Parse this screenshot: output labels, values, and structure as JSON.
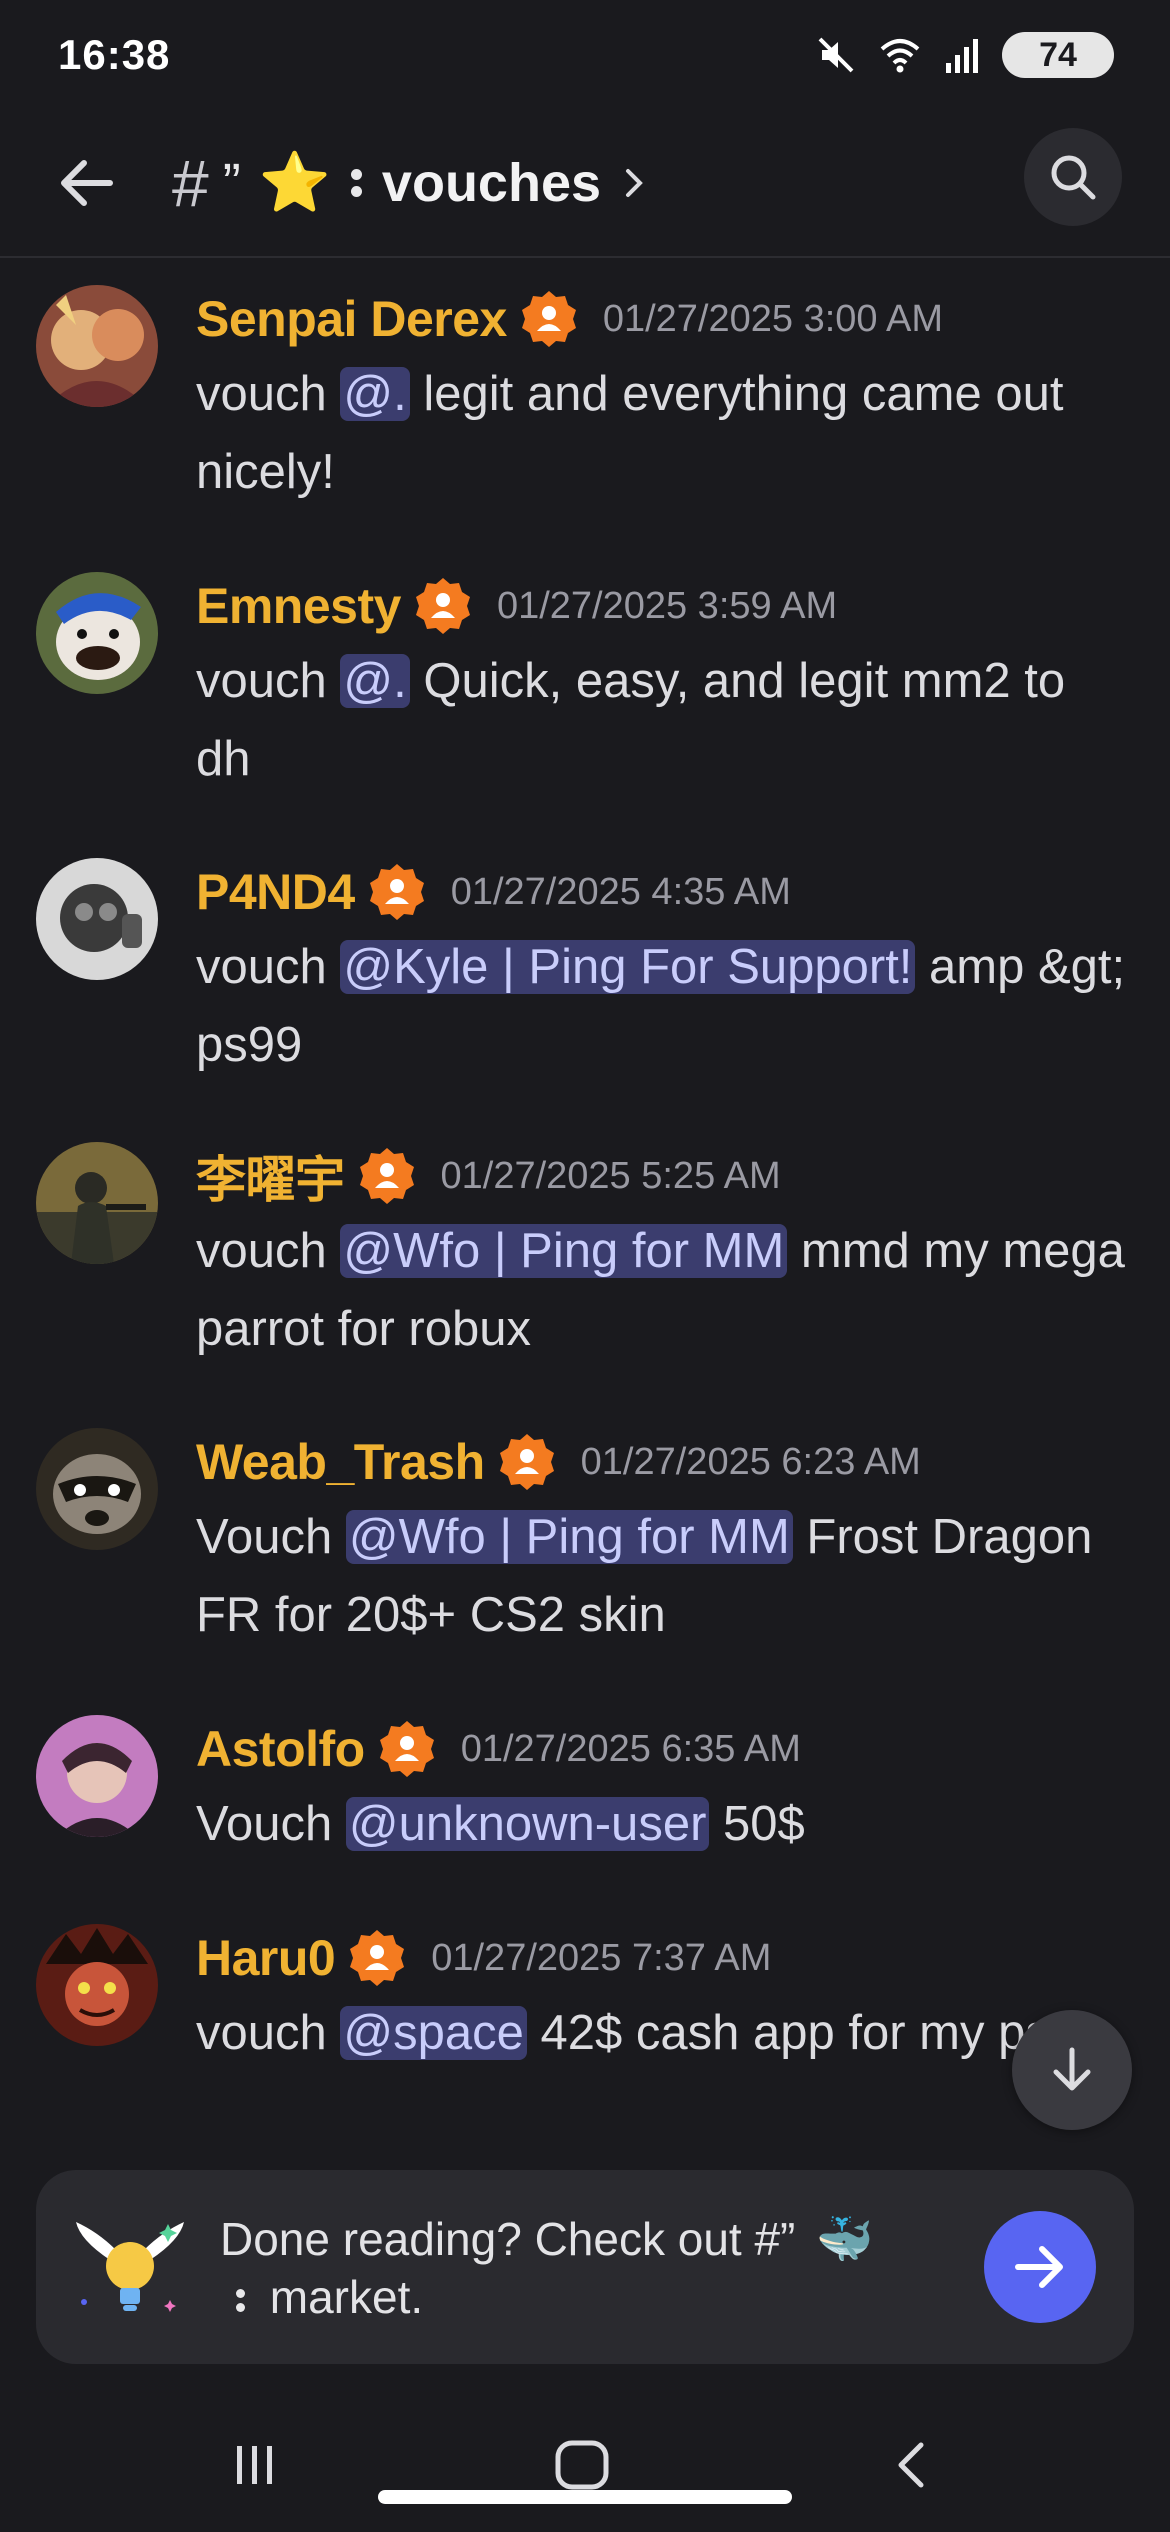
{
  "status_bar": {
    "time": "16:38",
    "battery": "74"
  },
  "header": {
    "hash": "#",
    "quote": "”",
    "star": "⭐",
    "channel_name": "vouches"
  },
  "messages": [
    {
      "username": "Senpai Derex",
      "timestamp": "01/27/2025 3:00 AM",
      "parts": [
        {
          "t": "text",
          "v": "vouch "
        },
        {
          "t": "mention",
          "v": "@."
        },
        {
          "t": "text",
          "v": " legit and everything came out nicely!"
        }
      ]
    },
    {
      "username": "Emnesty",
      "timestamp": "01/27/2025 3:59 AM",
      "parts": [
        {
          "t": "text",
          "v": "vouch "
        },
        {
          "t": "mention",
          "v": "@."
        },
        {
          "t": "text",
          "v": " Quick, easy, and legit mm2 to dh"
        }
      ]
    },
    {
      "username": "P4ND4",
      "timestamp": "01/27/2025 4:35 AM",
      "parts": [
        {
          "t": "text",
          "v": "vouch "
        },
        {
          "t": "mention",
          "v": "@Kyle | Ping For Support!"
        },
        {
          "t": "text",
          "v": " amp &gt; ps99"
        }
      ]
    },
    {
      "username": "李曜宇",
      "timestamp": "01/27/2025 5:25 AM",
      "parts": [
        {
          "t": "text",
          "v": "vouch "
        },
        {
          "t": "mention",
          "v": "@Wfo | Ping for MM"
        },
        {
          "t": "text",
          "v": " mmd my mega parrot for robux"
        }
      ]
    },
    {
      "username": "Weab_Trash",
      "timestamp": "01/27/2025 6:23 AM",
      "parts": [
        {
          "t": "text",
          "v": "Vouch "
        },
        {
          "t": "mention",
          "v": "@Wfo | Ping for MM"
        },
        {
          "t": "text",
          "v": " Frost Dragon FR for 20$+ CS2 skin"
        }
      ]
    },
    {
      "username": "Astolfo",
      "timestamp": "01/27/2025 6:35 AM",
      "parts": [
        {
          "t": "text",
          "v": "Vouch "
        },
        {
          "t": "mention",
          "v": "@unknown-user"
        },
        {
          "t": "text",
          "v": " 50$"
        }
      ]
    },
    {
      "username": "Haru0",
      "timestamp": "01/27/2025 7:37 AM",
      "parts": [
        {
          "t": "text",
          "v": "vouch "
        },
        {
          "t": "mention",
          "v": "@space"
        },
        {
          "t": "text",
          "v": " 42$ cash app for my ps99"
        }
      ]
    }
  ],
  "promo": {
    "line1": "Done reading? Check out #”",
    "whale": "🐳",
    "line2": "market."
  },
  "colors": {
    "background": "#1a1a1e",
    "username": "#f0b232",
    "mention_bg": "#3b3d6e",
    "mention_text": "#c9cdfb",
    "accent": "#5865f2",
    "badge": "#f47b20"
  },
  "icons": {
    "back": "arrow-left-icon",
    "search": "search-icon",
    "chevron": "chevron-right-icon",
    "fab": "arrow-down-icon",
    "promo": "winged-lightbulb-icon",
    "send": "arrow-right-icon",
    "badge": "person-badge-icon",
    "nav_recent": "recent-apps-icon",
    "nav_home": "home-icon",
    "nav_back": "back-icon"
  }
}
